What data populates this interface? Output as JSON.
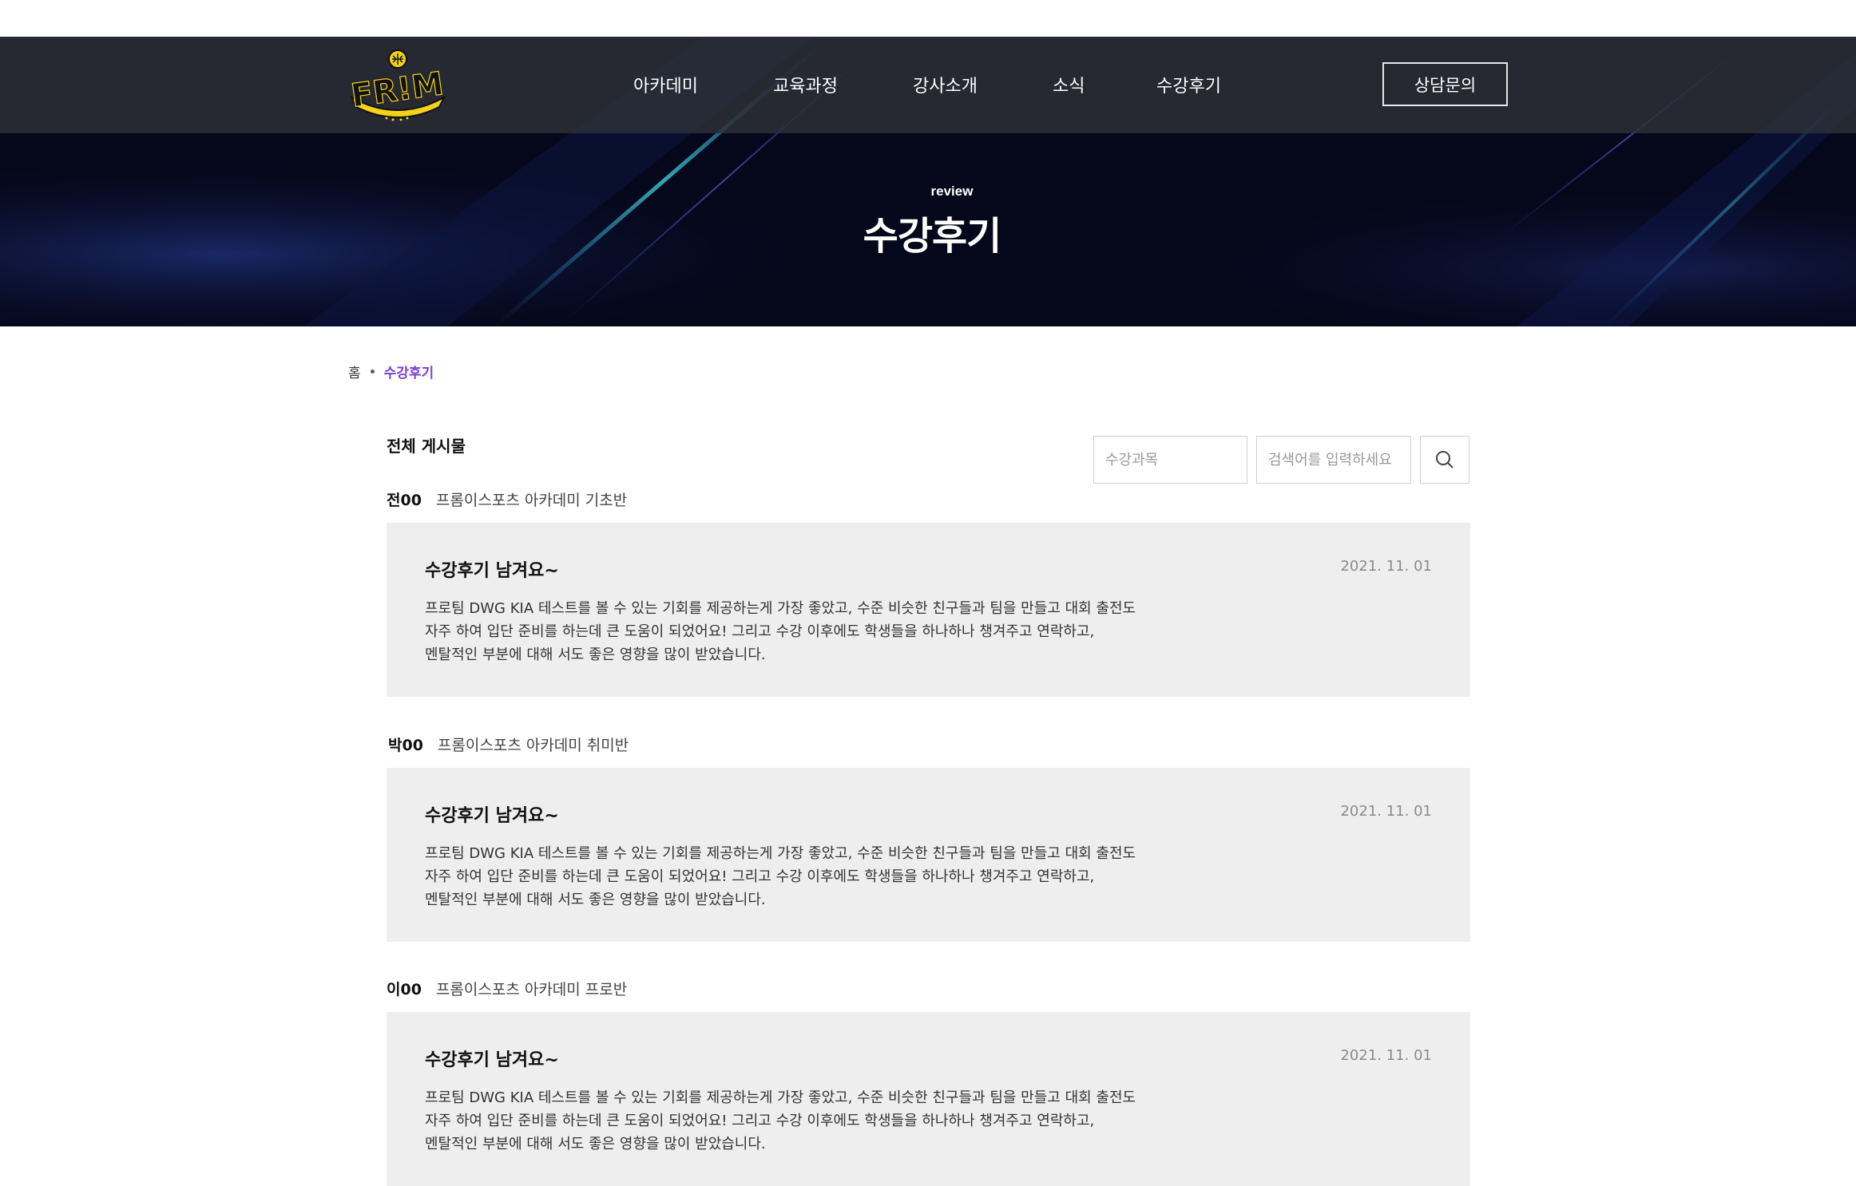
{
  "header": {
    "logo_text": "FROM",
    "nav": [
      "아카데미",
      "교육과정",
      "강사소개",
      "소식",
      "수강후기"
    ],
    "consult_label": "상담문의"
  },
  "hero": {
    "subtitle": "review",
    "title": "수강후기"
  },
  "breadcrumb": {
    "home": "홈",
    "current": "수강후기"
  },
  "board": {
    "section_title": "전체 게시물",
    "course_placeholder": "수강과목",
    "search_placeholder": "검색어를 입력하세요",
    "search_icon": "search-icon"
  },
  "reviews": [
    {
      "author": "전00",
      "course": "프롬이스포츠 아카데미 기초반",
      "title": "수강후기 남겨요~",
      "date": "2021. 11. 01",
      "body": [
        "프로팀 DWG KIA 테스트를 볼 수 있는 기회를 제공하는게 가장 좋았고, 수준 비슷한 친구들과 팀을 만들고 대회 출전도",
        "자주 하여 입단 준비를 하는데 큰 도움이 되었어요! 그리고 수강 이후에도 학생들을 하나하나 챙겨주고 연락하고,",
        "멘탈적인 부분에 대해 서도 좋은 영향을 많이 받았습니다."
      ]
    },
    {
      "author": "박00",
      "course": "프롬이스포츠 아카데미 취미반",
      "title": "수강후기 남겨요~",
      "date": "2021. 11. 01",
      "body": [
        "프로팀 DWG KIA 테스트를 볼 수 있는 기회를 제공하는게 가장 좋았고, 수준 비슷한 친구들과 팀을 만들고 대회 출전도",
        "자주 하여 입단 준비를 하는데 큰 도움이 되었어요! 그리고 수강 이후에도 학생들을 하나하나 챙겨주고 연락하고,",
        "멘탈적인 부분에 대해 서도 좋은 영향을 많이 받았습니다."
      ]
    },
    {
      "author": "이00",
      "course": "프롬이스포츠 아카데미 프로반",
      "title": "수강후기 남겨요~",
      "date": "2021. 11. 01",
      "body": [
        "프로팀 DWG KIA 테스트를 볼 수 있는 기회를 제공하는게 가장 좋았고, 수준 비슷한 친구들과 팀을 만들고 대회 출전도",
        "자주 하여 입단 준비를 하는데 큰 도움이 되었어요! 그리고 수강 이후에도 학생들을 하나하나 챙겨주고 연락하고,",
        "멘탈적인 부분에 대해 서도 좋은 영향을 많이 받았습니다."
      ]
    }
  ],
  "colors": {
    "accent": "#7b3fd6",
    "hero_bg": "#05071a",
    "card_bg": "#eeeeee",
    "logo_yellow": "#f2d21a"
  }
}
